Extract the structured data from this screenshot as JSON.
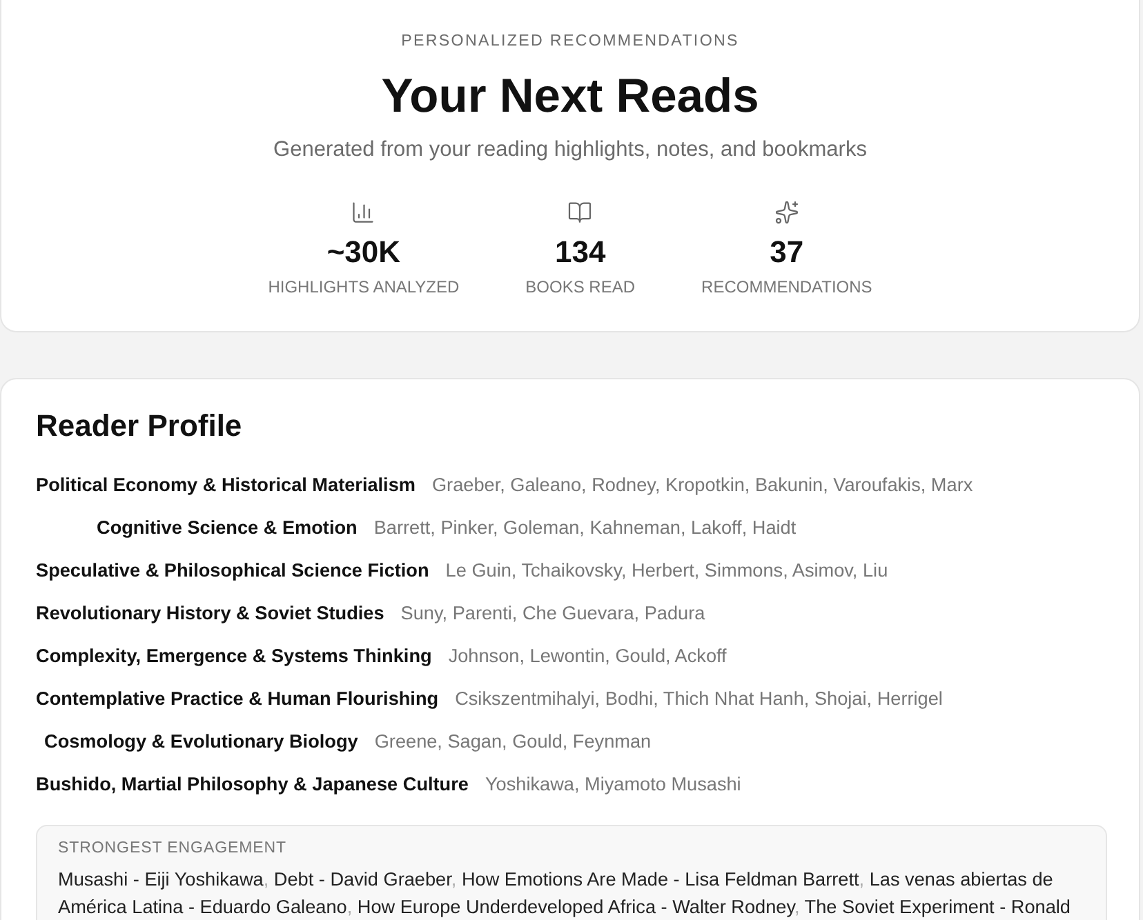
{
  "header": {
    "kicker": "PERSONALIZED RECOMMENDATIONS",
    "title": "Your Next Reads",
    "subtitle": "Generated from your reading highlights, notes, and bookmarks",
    "stats": [
      {
        "value": "~30K",
        "label": "HIGHLIGHTS ANALYZED"
      },
      {
        "value": "134",
        "label": "BOOKS READ"
      },
      {
        "value": "37",
        "label": "RECOMMENDATIONS"
      }
    ]
  },
  "reader_profile": {
    "title": "Reader Profile",
    "topics": [
      {
        "name": "Political Economy & Historical Materialism",
        "authors": "Graeber, Galeano, Rodney, Kropotkin, Bakunin, Varoufakis, Marx"
      },
      {
        "name": "Cognitive Science & Emotion",
        "authors": "Barrett, Pinker, Goleman, Kahneman, Lakoff, Haidt"
      },
      {
        "name": "Speculative & Philosophical Science Fiction",
        "authors": "Le Guin, Tchaikovsky, Herbert, Simmons, Asimov, Liu"
      },
      {
        "name": "Revolutionary History & Soviet Studies",
        "authors": "Suny, Parenti, Che Guevara, Padura"
      },
      {
        "name": "Complexity, Emergence & Systems Thinking",
        "authors": "Johnson, Lewontin, Gould, Ackoff"
      },
      {
        "name": "Contemplative Practice & Human Flourishing",
        "authors": "Csikszentmihalyi, Bodhi, Thich Nhat Hanh, Shojai, Herrigel"
      },
      {
        "name": "Cosmology & Evolutionary Biology",
        "authors": "Greene, Sagan, Gould, Feynman"
      },
      {
        "name": "Bushido, Martial Philosophy & Japanese Culture",
        "authors": "Yoshikawa, Miyamoto Musashi"
      }
    ],
    "strongest_engagement": {
      "label": "STRONGEST ENGAGEMENT",
      "separator": ",",
      "items": [
        "Musashi - Eiji Yoshikawa",
        "Debt - David Graeber",
        "How Emotions Are Made - Lisa Feldman Barrett",
        "Las venas abiertas de América Latina - Eduardo Galeano",
        "How Europe Underdeveloped Africa - Walter Rodney",
        "The Soviet Experiment - Ronald"
      ]
    }
  }
}
